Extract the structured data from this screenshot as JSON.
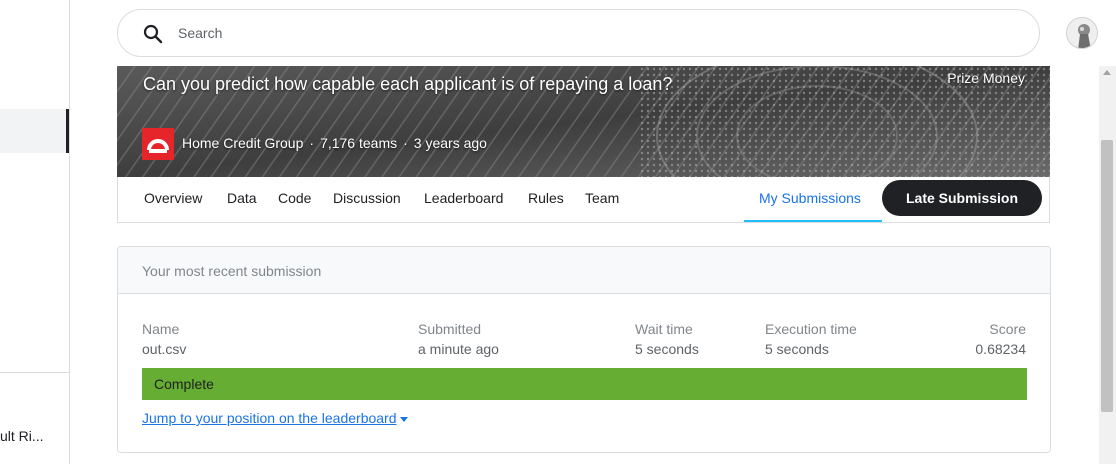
{
  "search": {
    "placeholder": "Search"
  },
  "sidebar": {
    "truncated_item": "ult Ri..."
  },
  "banner": {
    "title": "Can you predict how capable each applicant is of repaying a loan?",
    "prize_label": "Prize Money",
    "host": "Home Credit Group",
    "teams": "7,176 teams",
    "age": "3 years ago",
    "separator": "·"
  },
  "tabs": {
    "overview": "Overview",
    "data": "Data",
    "code": "Code",
    "discussion": "Discussion",
    "leaderboard": "Leaderboard",
    "rules": "Rules",
    "team": "Team",
    "my_submissions": "My Submissions",
    "late_submission": "Late Submission"
  },
  "submission": {
    "header": "Your most recent submission",
    "columns": {
      "name": "Name",
      "submitted": "Submitted",
      "wait": "Wait time",
      "execution": "Execution time",
      "score": "Score"
    },
    "values": {
      "name": "out.csv",
      "submitted": "a minute ago",
      "wait": "5 seconds",
      "execution": "5 seconds",
      "score": "0.68234"
    },
    "status": "Complete",
    "jump_link": "Jump to your position on the leaderboard"
  },
  "colors": {
    "status_green": "#66ad33",
    "accent_blue": "#1a73e8",
    "tab_underline": "#20beff",
    "brand_red": "#e5252a",
    "dark_button": "#202124"
  }
}
